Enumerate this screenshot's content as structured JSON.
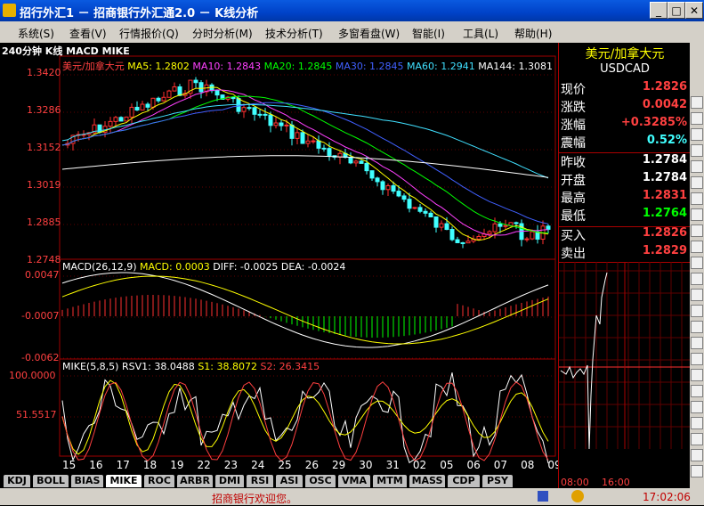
{
  "window": {
    "title": "招行外汇1 － 招商银行外汇通2.0 － K线分析",
    "min": "_",
    "max": "□",
    "close": "✕"
  },
  "menu": [
    "系统(S)",
    "查看(V)",
    "行情报价(Q)",
    "分时分析(M)",
    "技术分析(T)",
    "多窗看盘(W)",
    "智能(I)",
    "工具(L)",
    "帮助(H)"
  ],
  "chart": {
    "header": "240分钟 K线 MACD MIKE",
    "pair": "美元/加拿大元",
    "ma": [
      {
        "label": "MA5: 1.2802",
        "color": "#ffff00"
      },
      {
        "label": "MA10: 1.2843",
        "color": "#ff40ff"
      },
      {
        "label": "MA20: 1.2845",
        "color": "#00ff00"
      },
      {
        "label": "MA30: 1.2845",
        "color": "#4060ff"
      },
      {
        "label": "MA60: 1.2941",
        "color": "#40e0ff"
      },
      {
        "label": "MA144: 1.3081",
        "color": "#ffffff"
      }
    ],
    "price_ticks": [
      "1.3420",
      "1.3286",
      "1.3152",
      "1.3019",
      "1.2885",
      "1.2748"
    ],
    "macd_ticks": [
      "0.0047",
      "-0.0007",
      "-0.0062"
    ],
    "macd_legend": [
      {
        "label": "MACD(26,12,9)",
        "color": "#ffffff"
      },
      {
        "label": "MACD: 0.0003",
        "color": "#ffff00"
      },
      {
        "label": "DIFF: -0.0025",
        "color": "#ffffff"
      },
      {
        "label": "DEA: -0.0024",
        "color": "#ffffff"
      }
    ],
    "mike_ticks": [
      "100.0000",
      "51.5517"
    ],
    "mike_legend": [
      {
        "label": "MIKE(5,8,5)",
        "color": "#ffffff"
      },
      {
        "label": "RSV1: 38.0488",
        "color": "#ffffff"
      },
      {
        "label": "S1: 38.8072",
        "color": "#ffff00"
      },
      {
        "label": "S2: 26.3415",
        "color": "#ff4040"
      }
    ],
    "x_labels": [
      "15",
      "16",
      "17",
      "18",
      "19",
      "22",
      "23",
      "24",
      "25",
      "26",
      "29",
      "30",
      "31",
      "02",
      "05",
      "06",
      "07",
      "08",
      "09"
    ]
  },
  "quote": {
    "name": "美元/加拿大元",
    "code": "USDCAD",
    "rows": [
      {
        "label": "现价",
        "value": "1.2826",
        "color": "#ff4040"
      },
      {
        "label": "涨跌",
        "value": "0.0042",
        "color": "#ff4040"
      },
      {
        "label": "涨幅",
        "value": "+0.3285%",
        "color": "#ff4040"
      },
      {
        "label": "震幅",
        "value": "0.52%",
        "color": "#40ffff"
      },
      {
        "label": "昨收",
        "value": "1.2784",
        "color": "#ffffff"
      },
      {
        "label": "开盘",
        "value": "1.2784",
        "color": "#ffffff"
      },
      {
        "label": "最高",
        "value": "1.2831",
        "color": "#ff4040"
      },
      {
        "label": "最低",
        "value": "1.2764",
        "color": "#00ff00"
      },
      {
        "label": "买入",
        "value": "1.2826",
        "color": "#ff4040"
      },
      {
        "label": "卖出",
        "value": "1.2829",
        "color": "#ff4040"
      }
    ],
    "time_labels": [
      "08:00",
      "16:00"
    ]
  },
  "tabs": [
    "KDJ",
    "BOLL",
    "BIAS",
    "MIKE",
    "ROC",
    "ARBR",
    "DMI",
    "RSI",
    "ASI",
    "OSC",
    "VMA",
    "MTM",
    "MASS",
    "CDP",
    "PSY"
  ],
  "active_tab": "MIKE",
  "status": {
    "message": "招商银行欢迎您。",
    "time": "17:02:06"
  }
}
